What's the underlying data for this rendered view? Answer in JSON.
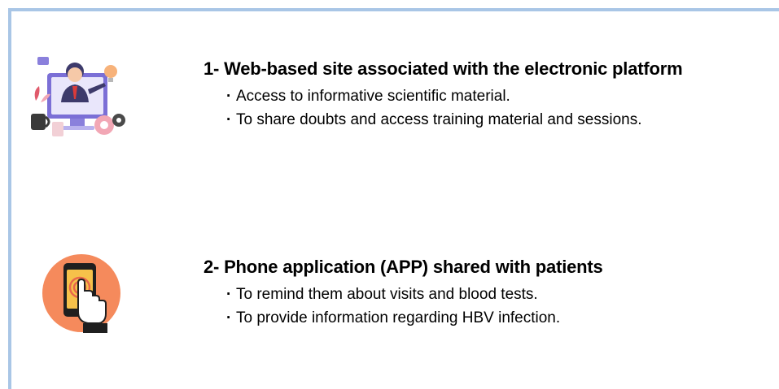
{
  "items": [
    {
      "icon": "online-training-presenter-icon",
      "title": "1- Web-based site associated with the electronic platform",
      "bullets": [
        "Access to informative scientific material.",
        "To share doubts and access training material and sessions."
      ]
    },
    {
      "icon": "smartphone-touch-icon",
      "title": "2- Phone application (APP) shared with patients",
      "bullets": [
        "To remind them about visits and blood tests.",
        "To provide information regarding HBV infection."
      ]
    }
  ],
  "bullet_glyph": "·",
  "colors": {
    "frame": "#a9c6e6",
    "accent_purple": "#6a5acd",
    "accent_pink": "#f2a7b5",
    "accent_orange": "#f58a5c"
  }
}
